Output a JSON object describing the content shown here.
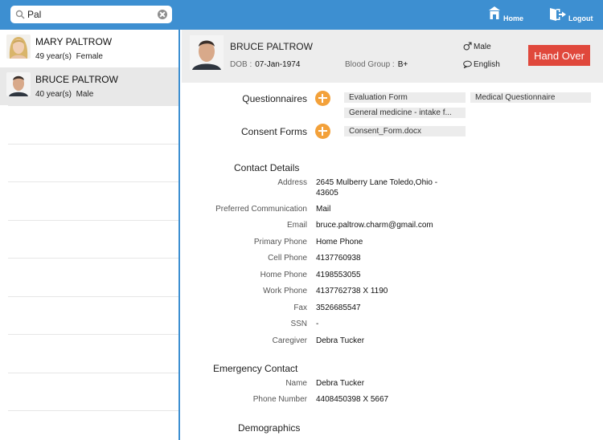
{
  "search": {
    "value": "Pal"
  },
  "topbar": {
    "home_label": "Home",
    "logout_label": "Logout"
  },
  "patients": [
    {
      "name": "MARY PALTROW",
      "age": "49 year(s)",
      "gender": "Female"
    },
    {
      "name": "BRUCE PALTROW",
      "age": "40 year(s)",
      "gender": "Male"
    }
  ],
  "header": {
    "name": "BRUCE PALTROW",
    "dob_label": "DOB :",
    "dob": "07-Jan-1974",
    "blood_label": "Blood Group :",
    "blood": "B+",
    "gender": "Male",
    "language": "English",
    "handover_label": "Hand Over"
  },
  "questionnaires": {
    "label": "Questionnaires",
    "items": [
      "Evaluation Form",
      "Medical Questionnaire",
      "General medicine - intake f..."
    ]
  },
  "consent": {
    "label": "Consent Forms",
    "items": [
      "Consent_Form.docx"
    ]
  },
  "contact": {
    "heading": "Contact Details",
    "rows": [
      {
        "label": "Address",
        "value": "2645 Mulberry Lane  Toledo,Ohio -",
        "value2": "43605"
      },
      {
        "label": "Preferred Communication",
        "value": "Mail"
      },
      {
        "label": "Email",
        "value": "bruce.paltrow.charm@gmail.com"
      },
      {
        "label": "Primary Phone",
        "value": "Home Phone"
      },
      {
        "label": "Cell Phone",
        "value": "4137760938"
      },
      {
        "label": "Home Phone",
        "value": "4198553055"
      },
      {
        "label": "Work Phone",
        "value": "4137762738 X 1190"
      },
      {
        "label": "Fax",
        "value": "3526685547"
      },
      {
        "label": "SSN",
        "value": "-"
      },
      {
        "label": "Caregiver",
        "value": "Debra Tucker"
      }
    ]
  },
  "emergency": {
    "heading": "Emergency Contact",
    "rows": [
      {
        "label": "Name",
        "value": "Debra Tucker"
      },
      {
        "label": "Phone Number",
        "value": "4408450398 X 5667"
      }
    ]
  },
  "demographics": {
    "heading": "Demographics"
  },
  "colors": {
    "topbar": "#3d8fd1",
    "accent": "#f3a13a",
    "handover": "#e0483c"
  }
}
